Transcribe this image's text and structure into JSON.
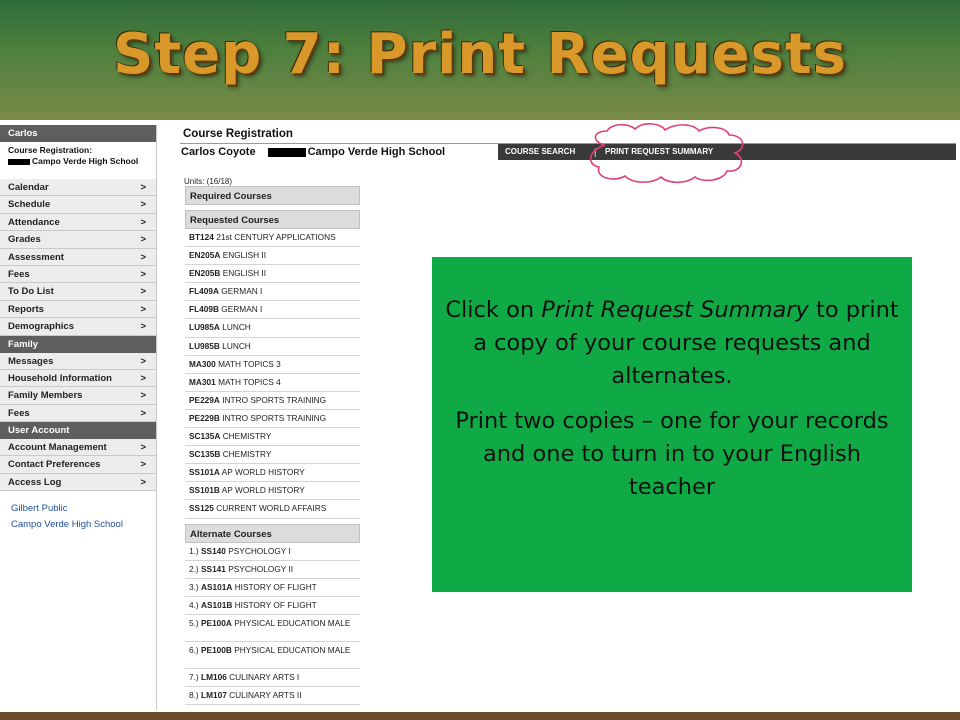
{
  "slide": {
    "title": "Step 7: Print Requests"
  },
  "sidebar": {
    "user_name": "Carlos",
    "context_label": "Course Registration:",
    "context_school": "Campo Verde High School",
    "items_top": [
      "Calendar",
      "Schedule",
      "Attendance",
      "Grades",
      "Assessment",
      "Fees",
      "To Do List",
      "Reports",
      "Demographics"
    ],
    "section_family": "Family",
    "items_family": [
      "Messages",
      "Household Information",
      "Family Members",
      "Fees"
    ],
    "section_account": "User Account",
    "items_account": [
      "Account Management",
      "Contact Preferences",
      "Access Log"
    ],
    "chevron": ">",
    "footer_links": [
      "Gilbert Public",
      "Campo Verde High School"
    ]
  },
  "main": {
    "heading": "Course Registration",
    "student_name": "Carlos Coyote",
    "school_name": "Campo Verde High School",
    "tab_course_search": "COURSE SEARCH",
    "tab_separator": "|",
    "tab_print_summary": "PRINT REQUEST SUMMARY",
    "units": "Units: (16/18)",
    "required_header": "Required Courses",
    "requested_header": "Requested Courses",
    "requested": [
      {
        "code": "BT124",
        "name": "21st CENTURY APPLICATIONS"
      },
      {
        "code": "EN205A",
        "name": "ENGLISH II"
      },
      {
        "code": "EN205B",
        "name": "ENGLISH II"
      },
      {
        "code": "FL409A",
        "name": "GERMAN I"
      },
      {
        "code": "FL409B",
        "name": "GERMAN I"
      },
      {
        "code": "LU985A",
        "name": "LUNCH"
      },
      {
        "code": "LU985B",
        "name": "LUNCH"
      },
      {
        "code": "MA300",
        "name": "MATH TOPICS 3"
      },
      {
        "code": "MA301",
        "name": "MATH TOPICS 4"
      },
      {
        "code": "PE229A",
        "name": "INTRO SPORTS TRAINING"
      },
      {
        "code": "PE229B",
        "name": "INTRO SPORTS TRAINING"
      },
      {
        "code": "SC135A",
        "name": "CHEMISTRY"
      },
      {
        "code": "SC135B",
        "name": "CHEMISTRY"
      },
      {
        "code": "SS101A",
        "name": "AP WORLD HISTORY"
      },
      {
        "code": "SS101B",
        "name": "AP WORLD HISTORY"
      },
      {
        "code": "SS125",
        "name": "CURRENT WORLD AFFAIRS"
      }
    ],
    "alternate_header": "Alternate Courses",
    "alternates": [
      {
        "num": "1.)",
        "code": "SS140",
        "name": "PSYCHOLOGY I"
      },
      {
        "num": "2.)",
        "code": "SS141",
        "name": "PSYCHOLOGY II"
      },
      {
        "num": "3.)",
        "code": "AS101A",
        "name": "HISTORY OF FLIGHT"
      },
      {
        "num": "4.)",
        "code": "AS101B",
        "name": "HISTORY OF FLIGHT"
      },
      {
        "num": "5.)",
        "code": "PE100A",
        "name": "PHYSICAL EDUCATION MALE"
      },
      {
        "num": "6.)",
        "code": "PE100B",
        "name": "PHYSICAL EDUCATION MALE"
      },
      {
        "num": "7.)",
        "code": "LM106",
        "name": "CULINARY ARTS I"
      },
      {
        "num": "8.)",
        "code": "LM107",
        "name": "CULINARY ARTS II"
      }
    ]
  },
  "callout": {
    "p1_before": "Click on ",
    "p1_emph": "Print Request Summary",
    "p1_after": "  to print a copy of your course requests and alternates.",
    "p2": "Print two copies – one for your records and one to turn in to your English teacher"
  },
  "colors": {
    "title_gold": "#d9982a",
    "callout_green": "#0faa45",
    "cloud_outline": "#e0407a"
  }
}
